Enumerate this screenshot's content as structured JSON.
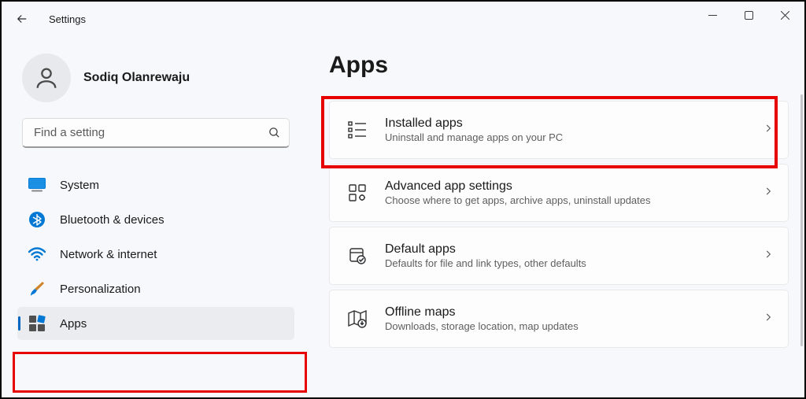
{
  "window": {
    "title": "Settings"
  },
  "profile": {
    "name": "Sodiq Olanrewaju"
  },
  "search": {
    "placeholder": "Find a setting"
  },
  "sidebar": {
    "items": [
      {
        "label": "System"
      },
      {
        "label": "Bluetooth & devices"
      },
      {
        "label": "Network & internet"
      },
      {
        "label": "Personalization"
      },
      {
        "label": "Apps"
      }
    ]
  },
  "page": {
    "title": "Apps"
  },
  "cards": [
    {
      "title": "Installed apps",
      "subtitle": "Uninstall and manage apps on your PC"
    },
    {
      "title": "Advanced app settings",
      "subtitle": "Choose where to get apps, archive apps, uninstall updates"
    },
    {
      "title": "Default apps",
      "subtitle": "Defaults for file and link types, other defaults"
    },
    {
      "title": "Offline maps",
      "subtitle": "Downloads, storage location, map updates"
    }
  ]
}
